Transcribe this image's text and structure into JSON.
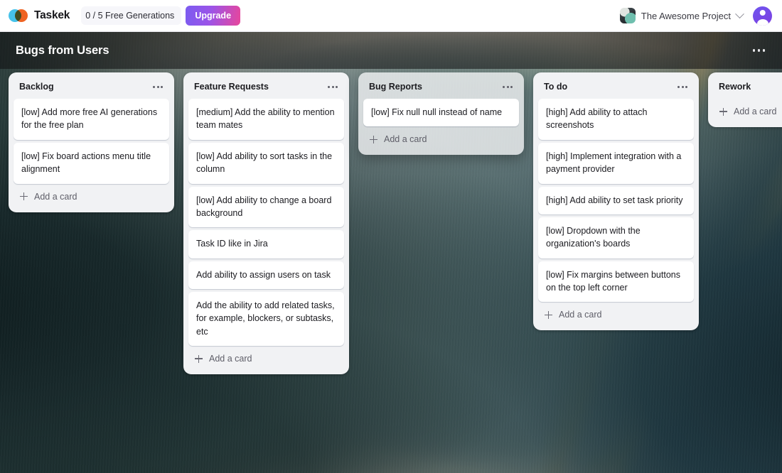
{
  "topbar": {
    "brand_name": "Taskek",
    "logo_icon": "taskek-logo-icon",
    "generations_badge": "0 / 5 Free Generations",
    "upgrade_label": "Upgrade",
    "project_name": "The Awesome Project",
    "project_thumb_icon": "project-thumbnail-icon",
    "chevron_icon": "chevron-down-icon",
    "avatar_icon": "user-avatar-icon",
    "accent_gradient_from": "#7b5cf0",
    "accent_gradient_to": "#e8469b"
  },
  "board": {
    "title": "Bugs from Users",
    "menu_icon": "board-more-options-icon"
  },
  "columns": [
    {
      "title": "Backlog",
      "menu_icon": "column-more-options-icon",
      "dragging": false,
      "add_card_label": "Add a card",
      "cards": [
        "[low] Add more free AI generations for the free plan",
        "[low] Fix board actions menu title alignment"
      ]
    },
    {
      "title": "Feature Requests",
      "menu_icon": "column-more-options-icon",
      "dragging": false,
      "add_card_label": "Add a card",
      "cards": [
        "[medium] Add the ability to mention team mates",
        "[low] Add ability to sort tasks in the column",
        "[low] Add ability to change a board background",
        "Task ID like in Jira",
        "Add ability to assign users on task",
        "Add the ability to add related tasks, for example, blockers, or subtasks, etc"
      ]
    },
    {
      "title": "Bug Reports",
      "menu_icon": "column-more-options-icon",
      "dragging": true,
      "add_card_label": "Add a card",
      "cards": [
        "[low] Fix null null instead of name"
      ]
    },
    {
      "title": "To do",
      "menu_icon": "column-more-options-icon",
      "dragging": false,
      "add_card_label": "Add a card",
      "cards": [
        "[high] Add ability to attach screenshots",
        "[high] Implement integration with a payment provider",
        "[high] Add ability to set task priority",
        "[low] Dropdown with the organization's boards",
        "[low] Fix margins between buttons on the top left corner"
      ]
    },
    {
      "title": "Rework",
      "menu_icon": "column-more-options-icon",
      "dragging": false,
      "add_card_label": "Add a card",
      "cards": []
    }
  ]
}
